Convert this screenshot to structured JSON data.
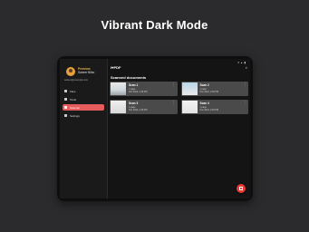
{
  "headline": "Vibrant Dark Mode",
  "drawer": {
    "premium_label": "Premium",
    "user_name": "Saheer Bilbo",
    "email": "saheer@example.com",
    "items": [
      {
        "label": "Files",
        "icon": "folder-icon"
      },
      {
        "label": "Tools",
        "icon": "tools-icon"
      },
      {
        "label": "Scanner",
        "icon": "scanner-icon"
      },
      {
        "label": "Settings",
        "icon": "gear-icon"
      }
    ]
  },
  "appbar": {
    "logo": "I♥PDF"
  },
  "section_title": "Scanned documents",
  "cards": [
    {
      "title": "Scan 1",
      "meta1": "1 page",
      "meta2": "Nov 2022, 2:48 PM"
    },
    {
      "title": "Scan 2",
      "meta1": "1 page",
      "meta2": "Nov 2022, 2:48 PM"
    },
    {
      "title": "Scan 3",
      "meta1": "1 page",
      "meta2": "Nov 2022, 2:48 PM"
    },
    {
      "title": "Scan 4",
      "meta1": "1 page",
      "meta2": "Nov 2022, 2:48 PM"
    }
  ],
  "colors": {
    "accent": "#e65c5c",
    "fab": "#e53935",
    "premium": "#e7b34a"
  }
}
